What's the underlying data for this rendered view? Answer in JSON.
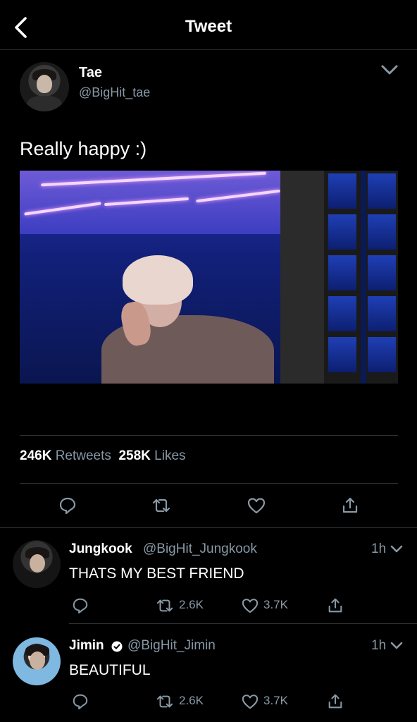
{
  "header": {
    "title": "Tweet",
    "back_icon": "chevron-left-icon"
  },
  "tweet": {
    "author_name": "Tae",
    "author_handle": "@BigHit_tae",
    "text": "Really happy :)",
    "retweets_count": "246K",
    "retweets_label": "Retweets",
    "likes_count": "258K",
    "likes_label": "Likes"
  },
  "replies": [
    {
      "name": "Jungkook",
      "handle": "@BigHit_Jungkook",
      "verified": false,
      "time": "1h",
      "text": "THATS MY BEST FRIEND",
      "retweets": "2.6K",
      "likes": "3.7K"
    },
    {
      "name": "Jimin",
      "handle": "@BigHit_Jimin",
      "verified": true,
      "time": "1h",
      "text": "BEAUTIFUL",
      "retweets": "2.6K",
      "likes": "3.7K"
    }
  ],
  "colors": {
    "background": "#000000",
    "text": "#ffffff",
    "secondary": "#8899a6",
    "divider": "#2f3336"
  }
}
